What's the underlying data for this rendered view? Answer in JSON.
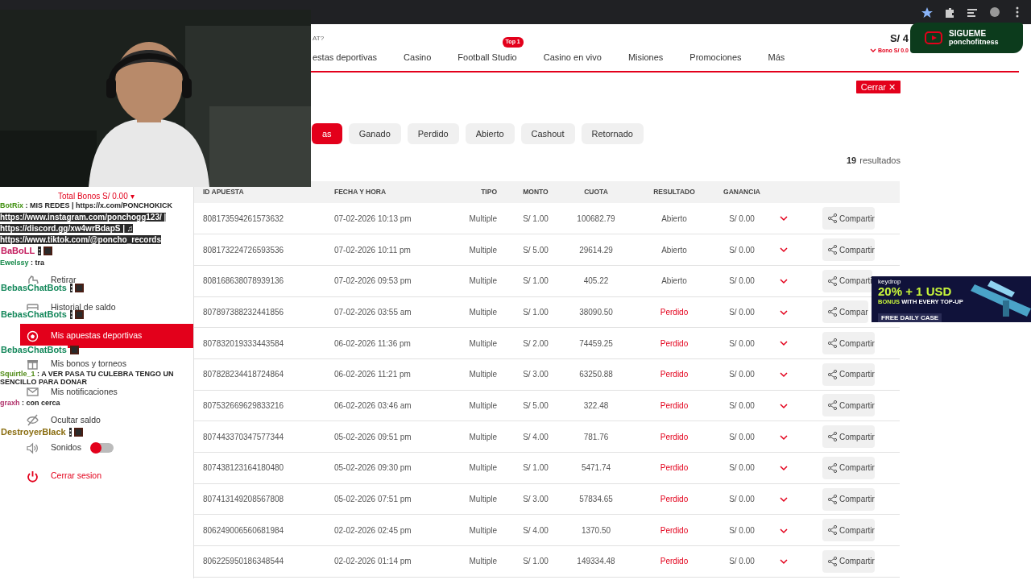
{
  "header": {
    "top_text": "AT?",
    "nav": [
      {
        "label": "estas deportivas"
      },
      {
        "label": "Casino"
      },
      {
        "label": "Football Studio",
        "badge": "Top 1"
      },
      {
        "label": "Casino en vivo"
      },
      {
        "label": "Misiones"
      },
      {
        "label": "Promociones"
      },
      {
        "label": "Más"
      }
    ],
    "balance": "S/ 4",
    "bonus": "Bono S/ 0.0"
  },
  "close_button": "Cerrar ✕",
  "filters": [
    {
      "label": "as",
      "selected": true
    },
    {
      "label": "Ganado",
      "selected": false
    },
    {
      "label": "Perdido",
      "selected": false
    },
    {
      "label": "Abierto",
      "selected": false
    },
    {
      "label": "Cashout",
      "selected": false
    },
    {
      "label": "Retornado",
      "selected": false
    }
  ],
  "results": {
    "count": "19",
    "label": "resultados"
  },
  "sidebar": {
    "total_bonus": "Total Bonos S/ 0.00 ▾",
    "items": [
      {
        "label": "Retirar",
        "selected": false
      },
      {
        "label": "Historial de saldo",
        "selected": false
      },
      {
        "label": "Mis apuestas deportivas",
        "selected": true
      },
      {
        "label": "Mis bonos y torneos",
        "selected": false
      },
      {
        "label": "Mis notificaciones",
        "selected": false
      },
      {
        "label": "Ocultar saldo",
        "selected": false
      },
      {
        "label": "Sonidos",
        "selected": false,
        "kind": "toggle",
        "on": false
      },
      {
        "label": "Cerrar sesion",
        "selected": false,
        "kind": "danger"
      }
    ]
  },
  "table": {
    "columns": [
      "ID APUESTA",
      "FECHA Y HORA",
      "TIPO",
      "MONTO",
      "CUOTA",
      "RESULTADO",
      "GANANCIA"
    ],
    "rows": [
      {
        "id": "808173594261573632",
        "date": "07-02-2026 10:13 pm",
        "type": "Multiple",
        "amount": "S/ 1.00",
        "odds": "100682.79",
        "result": "Abierto",
        "kind": "open",
        "profit": "S/ 0.00",
        "share": "Compartir"
      },
      {
        "id": "808173224726593536",
        "date": "07-02-2026 10:11 pm",
        "type": "Multiple",
        "amount": "S/ 5.00",
        "odds": "29614.29",
        "result": "Abierto",
        "kind": "open",
        "profit": "S/ 0.00",
        "share": "Compartir"
      },
      {
        "id": "808168638078939136",
        "date": "07-02-2026 09:53 pm",
        "type": "Multiple",
        "amount": "S/ 1.00",
        "odds": "405.22",
        "result": "Abierto",
        "kind": "open",
        "profit": "S/ 0.00",
        "share": "Comparti"
      },
      {
        "id": "807897388232441856",
        "date": "07-02-2026 03:55 am",
        "type": "Multiple",
        "amount": "S/ 1.00",
        "odds": "38090.50",
        "result": "Perdido",
        "kind": "lost",
        "profit": "S/ 0.00",
        "share": "Compar"
      },
      {
        "id": "807832019333443584",
        "date": "06-02-2026 11:36 pm",
        "type": "Multiple",
        "amount": "S/ 2.00",
        "odds": "74459.25",
        "result": "Perdido",
        "kind": "lost",
        "profit": "S/ 0.00",
        "share": "Compartir"
      },
      {
        "id": "807828234418724864",
        "date": "06-02-2026 11:21 pm",
        "type": "Multiple",
        "amount": "S/ 3.00",
        "odds": "63250.88",
        "result": "Perdido",
        "kind": "lost",
        "profit": "S/ 0.00",
        "share": "Compartir"
      },
      {
        "id": "807532669629833216",
        "date": "06-02-2026 03:46 am",
        "type": "Multiple",
        "amount": "S/ 5.00",
        "odds": "322.48",
        "result": "Perdido",
        "kind": "lost",
        "profit": "S/ 0.00",
        "share": "Compartir"
      },
      {
        "id": "807443370347577344",
        "date": "05-02-2026 09:51 pm",
        "type": "Multiple",
        "amount": "S/ 4.00",
        "odds": "781.76",
        "result": "Perdido",
        "kind": "lost",
        "profit": "S/ 0.00",
        "share": "Compartir"
      },
      {
        "id": "807438123164180480",
        "date": "05-02-2026 09:30 pm",
        "type": "Multiple",
        "amount": "S/ 1.00",
        "odds": "5471.74",
        "result": "Perdido",
        "kind": "lost",
        "profit": "S/ 0.00",
        "share": "Compartir"
      },
      {
        "id": "807413149208567808",
        "date": "05-02-2026 07:51 pm",
        "type": "Multiple",
        "amount": "S/ 3.00",
        "odds": "57834.65",
        "result": "Perdido",
        "kind": "lost",
        "profit": "S/ 0.00",
        "share": "Compartir"
      },
      {
        "id": "806249006560681984",
        "date": "02-02-2026 02:45 pm",
        "type": "Multiple",
        "amount": "S/ 4.00",
        "odds": "1370.50",
        "result": "Perdido",
        "kind": "lost",
        "profit": "S/ 0.00",
        "share": "Compartir"
      },
      {
        "id": "806225950186348544",
        "date": "02-02-2026 01:14 pm",
        "type": "Multiple",
        "amount": "S/ 1.00",
        "odds": "149334.48",
        "result": "Perdido",
        "kind": "lost",
        "profit": "S/ 0.00",
        "share": "Compartir"
      }
    ]
  },
  "chat": [
    {
      "user": "BotRix",
      "color": "#3f8f0e",
      "text": ": MIS REDES | https://x.com/PONCHOKICK"
    },
    {
      "text": "https://www.instagram.com/ponchogg123/ |"
    },
    {
      "text": "https://discord.gg/xw4wrBdapS | ♫"
    },
    {
      "text": "https://www.tiktok.com/@poncho_records"
    },
    {
      "user": "BaBoLL",
      "color": "#c2185b",
      "text": ":",
      "emote": true
    },
    {
      "user": "Ewelssy",
      "color": "#16894a",
      "text": ": tra"
    },
    {
      "user": "BebasChatBots",
      "color": "#13875a",
      "text": ":",
      "emote": true
    },
    {
      "user": "BebasChatBots",
      "color": "#13875a",
      "text": ":",
      "emote": true
    },
    {
      "user": "BebasChatBots",
      "color": "#13875a",
      "emote": true
    },
    {
      "user": "Squirtle_1",
      "color": "#4f8a16",
      "text": ": A VER PASA TU CULEBRA TENGO UN SENCILLO PARA DONAR"
    },
    {
      "user": "graxh",
      "color": "#b0306a",
      "text": ": con cerca"
    },
    {
      "user": "DestroyerBlack",
      "color": "#8a6d10",
      "text": ":",
      "emote": true
    }
  ],
  "follow_badge": {
    "title": "SIGUEME",
    "handle": "ponchofitness"
  },
  "ad": {
    "brand": "keydrop",
    "headline": "20% + 1 USD",
    "sub_bold": "BONUS",
    "sub": "WITH EVERY TOP-UP",
    "cta": "FREE DAILY CASE"
  }
}
